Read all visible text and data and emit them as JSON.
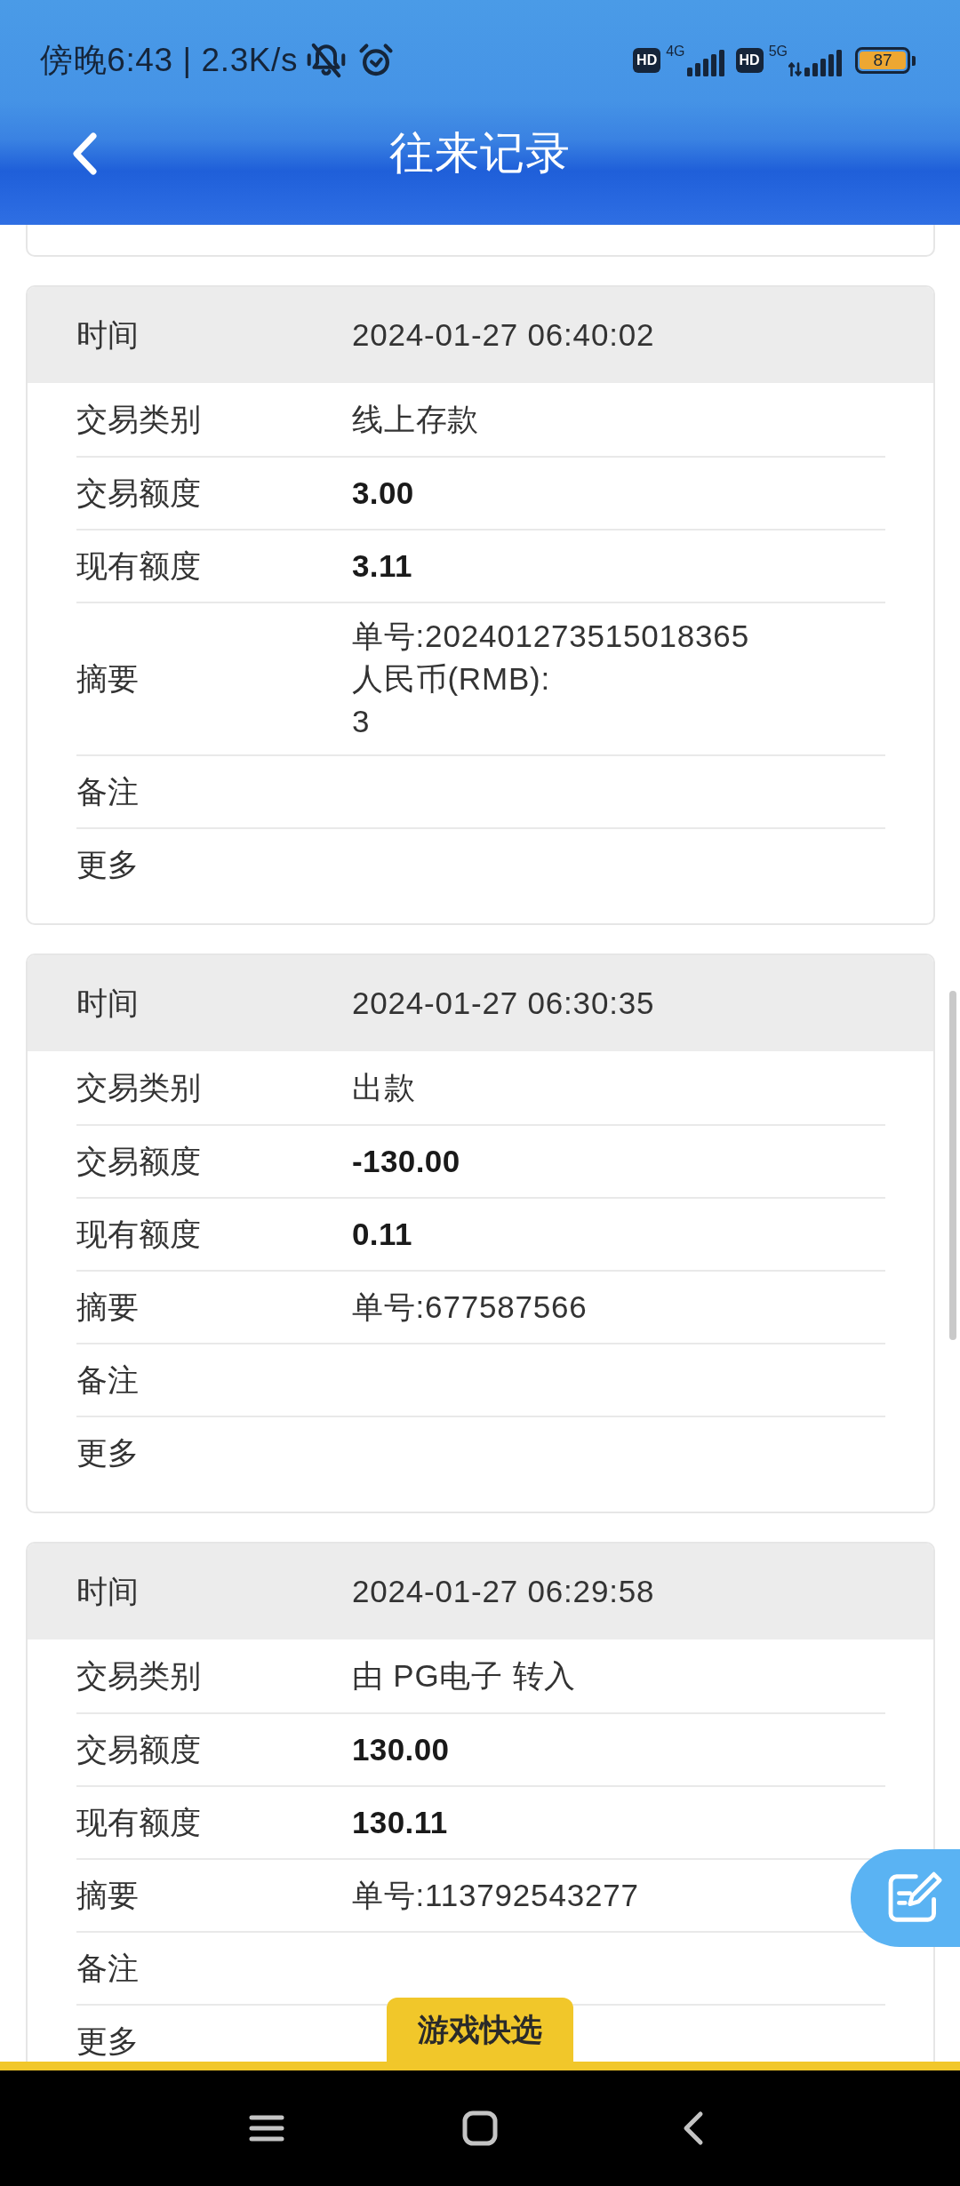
{
  "status_bar": {
    "time": "傍晚6:43 | 2.3K/s",
    "sims": [
      {
        "kind": "standby",
        "hd": "HD",
        "network": "4G"
      },
      {
        "kind": "data",
        "hd": "HD",
        "network": "5G"
      }
    ],
    "battery": "87"
  },
  "header": {
    "title": "往来记录"
  },
  "records": [
    {
      "fields": [
        {
          "kind": "head",
          "label": "时间",
          "value": "2024-01-27 06:40:02"
        },
        {
          "kind": "text",
          "label": "交易类别",
          "value": "线上存款"
        },
        {
          "kind": "amount",
          "label": "交易额度",
          "value": "3.00"
        },
        {
          "kind": "amount",
          "label": "现有额度",
          "value": "3.11"
        },
        {
          "kind": "lines",
          "label": "摘要",
          "lines": [
            "单号:202401273515018365",
            "人民币(RMB):",
            "3"
          ]
        },
        {
          "kind": "text",
          "label": "备注"
        },
        {
          "kind": "text",
          "label": "更多"
        }
      ]
    },
    {
      "fields": [
        {
          "kind": "head",
          "label": "时间",
          "value": "2024-01-27 06:30:35"
        },
        {
          "kind": "text",
          "label": "交易类别",
          "value": "出款"
        },
        {
          "kind": "amount",
          "label": "交易额度",
          "value": "-130.00"
        },
        {
          "kind": "amount",
          "label": "现有额度",
          "value": "0.11"
        },
        {
          "kind": "text",
          "label": "摘要",
          "value": "单号:677587566"
        },
        {
          "kind": "text",
          "label": "备注"
        },
        {
          "kind": "text",
          "label": "更多"
        }
      ]
    },
    {
      "fields": [
        {
          "kind": "head",
          "label": "时间",
          "value": "2024-01-27 06:29:58"
        },
        {
          "kind": "text",
          "label": "交易类别",
          "value": "由 PG电子 转入"
        },
        {
          "kind": "amount",
          "label": "交易额度",
          "value": "130.00"
        },
        {
          "kind": "amount",
          "label": "现有额度",
          "value": "130.11"
        },
        {
          "kind": "text",
          "label": "摘要",
          "value": "单号:113792543277"
        },
        {
          "kind": "text",
          "label": "备注"
        },
        {
          "kind": "text",
          "label": "更多"
        }
      ]
    }
  ],
  "quick_tab": {
    "label": "游戏快选"
  }
}
